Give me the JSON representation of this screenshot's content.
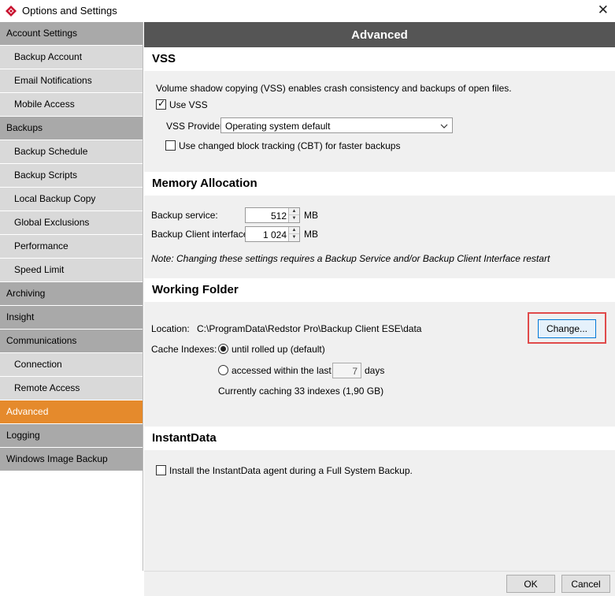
{
  "window": {
    "title": "Options and Settings"
  },
  "sidebar": {
    "items": [
      {
        "label": "Account Settings",
        "type": "category"
      },
      {
        "label": "Backup Account",
        "type": "sub"
      },
      {
        "label": "Email Notifications",
        "type": "sub"
      },
      {
        "label": "Mobile Access",
        "type": "sub"
      },
      {
        "label": "Backups",
        "type": "category"
      },
      {
        "label": "Backup Schedule",
        "type": "sub"
      },
      {
        "label": "Backup Scripts",
        "type": "sub"
      },
      {
        "label": "Local Backup Copy",
        "type": "sub"
      },
      {
        "label": "Global Exclusions",
        "type": "sub"
      },
      {
        "label": "Performance",
        "type": "sub"
      },
      {
        "label": "Speed Limit",
        "type": "sub"
      },
      {
        "label": "Archiving",
        "type": "category"
      },
      {
        "label": "Insight",
        "type": "category"
      },
      {
        "label": "Communications",
        "type": "category"
      },
      {
        "label": "Connection",
        "type": "sub"
      },
      {
        "label": "Remote Access",
        "type": "sub"
      },
      {
        "label": "Advanced",
        "type": "active"
      },
      {
        "label": "Logging",
        "type": "category"
      },
      {
        "label": "Windows Image Backup",
        "type": "category"
      }
    ]
  },
  "content": {
    "header": "Advanced",
    "vss": {
      "title": "VSS",
      "description": "Volume shadow copying (VSS) enables crash consistency and backups of open files.",
      "use_vss_label": "Use VSS",
      "use_vss_checked": true,
      "provider_label": "VSS Provider:",
      "provider_value": "Operating system default",
      "cbt_label": "Use changed block tracking (CBT) for faster backups",
      "cbt_checked": false
    },
    "memory": {
      "title": "Memory Allocation",
      "backup_service_label": "Backup service:",
      "backup_service_value": "512",
      "client_interface_label": "Backup Client interface:",
      "client_interface_value": "1 024",
      "unit": "MB",
      "note": "Note: Changing these settings requires a Backup Service and/or Backup Client Interface restart"
    },
    "working_folder": {
      "title": "Working Folder",
      "location_label": "Location:",
      "location_value": "C:\\ProgramData\\Redstor Pro\\Backup Client ESE\\data",
      "change_button": "Change...",
      "cache_label": "Cache Indexes:",
      "option_rolled_up": "until rolled up (default)",
      "option_accessed": "accessed within the last",
      "days_value": "7",
      "days_unit": "days",
      "caching_status": "Currently caching 33 indexes (1,90 GB)"
    },
    "instantdata": {
      "title": "InstantData",
      "install_label": "Install the InstantData agent during a Full System Backup.",
      "install_checked": false
    }
  },
  "footer": {
    "ok": "OK",
    "cancel": "Cancel"
  },
  "colors": {
    "accent": "#e58a2c",
    "header_bg": "#555555",
    "highlight": "#e04a4a",
    "brand": "#c8102e"
  }
}
